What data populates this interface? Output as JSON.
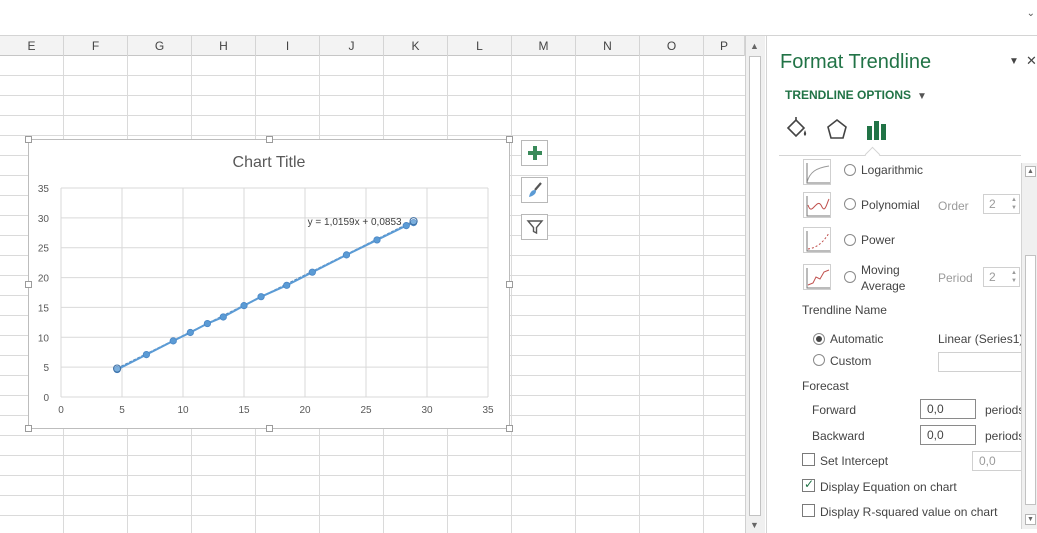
{
  "columns": [
    "E",
    "F",
    "G",
    "H",
    "I",
    "J",
    "K",
    "L",
    "M",
    "N",
    "O",
    "P"
  ],
  "chart": {
    "title": "Chart Title",
    "equation": "y = 1,0159x + 0,0853",
    "buttons": [
      "chart-elements-plus-icon",
      "chart-styles-brush-icon",
      "chart-filters-funnel-icon"
    ]
  },
  "chart_data": {
    "type": "scatter",
    "title": "Chart Title",
    "xlabel": "",
    "ylabel": "",
    "xlim": [
      0,
      35
    ],
    "ylim": [
      0,
      35
    ],
    "xticks": [
      "0",
      "5",
      "10",
      "15",
      "20",
      "25",
      "30",
      "35"
    ],
    "yticks": [
      "0",
      "5",
      "10",
      "15",
      "20",
      "25",
      "30",
      "35"
    ],
    "grid": true,
    "series": [
      {
        "x": [
          4.6,
          7.0,
          9.2,
          10.6,
          12.0,
          13.3,
          15.0,
          16.4,
          18.5,
          20.6,
          23.4,
          25.9,
          28.3,
          28.9
        ],
        "y": [
          4.6,
          7.1,
          9.4,
          10.8,
          12.3,
          13.4,
          15.3,
          16.8,
          18.7,
          20.9,
          23.8,
          26.3,
          28.7,
          29.2
        ]
      }
    ],
    "trendline": {
      "type": "linear",
      "slope": 1.0159,
      "intercept": 0.0853,
      "equation": "y = 1,0159x + 0,0853",
      "x_range": [
        4.6,
        28.9
      ]
    },
    "colors": {
      "series": "#5b9bd5",
      "grid": "#d9d9d9",
      "axis_text": "#595959"
    }
  },
  "pane": {
    "title": "Format Trendline",
    "dropdown_label": "▼",
    "close_label": "✕",
    "section": "TRENDLINE OPTIONS",
    "section_arrow": "▼",
    "tabs": [
      "fill-line-bucket-icon",
      "effects-pentagon-icon",
      "trendline-options-bars-icon"
    ],
    "types": {
      "logarithmic": "Logarithmic",
      "polynomial": "Polynomial",
      "order_label": "Order",
      "order_value": "2",
      "power": "Power",
      "moving_line1": "Moving",
      "moving_line2": "Average",
      "period_label": "Period",
      "period_value": "2"
    },
    "trendline_name": {
      "heading": "Trendline Name",
      "automatic": "Automatic",
      "automatic_value": "Linear (Series1)",
      "custom": "Custom",
      "custom_value": ""
    },
    "forecast": {
      "heading": "Forecast",
      "forward_label": "Forward",
      "forward_value": "0,0",
      "backward_label": "Backward",
      "backward_value": "0,0",
      "unit": "periods"
    },
    "intercept": {
      "label": "Set Intercept",
      "value": "0,0",
      "checked": false
    },
    "display_equation": {
      "label": "Display Equation on chart",
      "checked": true
    },
    "display_rsq": {
      "label": "Display R-squared value on chart",
      "checked": false
    },
    "accent": "#217346"
  }
}
